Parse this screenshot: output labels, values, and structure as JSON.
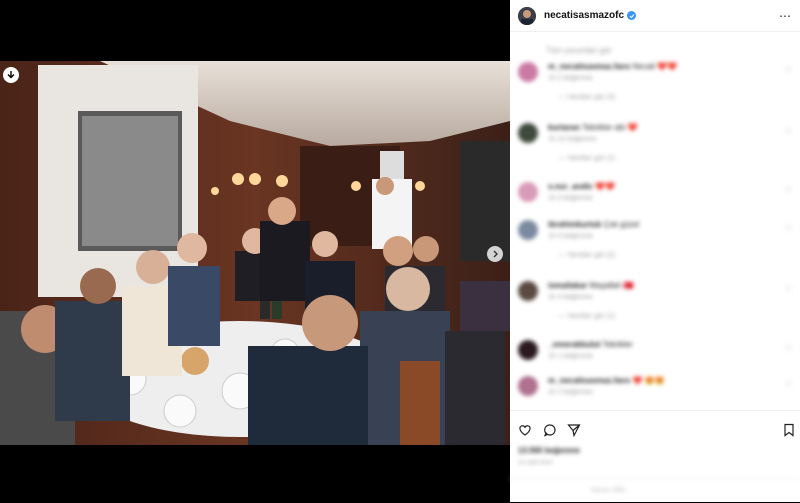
{
  "post": {
    "username": "necatisasmazofc",
    "more_icon": "⋯"
  },
  "comments": {
    "see_all": "Tüm yorumları gör",
    "items": [
      {
        "user": "m_necatisasmaz.fans",
        "text": "Necati ❤️❤️",
        "meta": "1h  2 beğenme",
        "reply": "—  Yanıtları gör (3)"
      },
      {
        "user": "kurtaran",
        "text": "Tebrikler abi ❤️",
        "meta": "1h  10 beğenme",
        "reply": "—  Yanıtları gör (1)"
      },
      {
        "user": "s.nur_andic",
        "text": "❤️❤️",
        "meta": "1h  3 beğenme",
        "reply": ""
      },
      {
        "user": "ibrahimkurtuk",
        "text": "Çok güzel",
        "meta": "1h  5 beğenme",
        "reply": "—  Yanıtları gör (2)"
      },
      {
        "user": "ismailakar",
        "text": "Maşallah 🇹🇷",
        "meta": "1h  4 beğenme",
        "reply": "—  Yanıtları gör (1)"
      },
      {
        "user": "_omerakbulut",
        "text": "Tebrikler",
        "meta": "1h  1 beğenme",
        "reply": ""
      },
      {
        "user": "m_necatisasmaz.fans",
        "text": "❤️ 😍😍",
        "meta": "1h  2 beğenme",
        "reply": ""
      }
    ]
  },
  "likes": "13.560 beğenme",
  "date": "15 saat önce",
  "add_comment": "Yorum ekle...",
  "colors": {
    "avatar_colors": [
      "#c97aa3",
      "#3f4a3c",
      "#d89ab8",
      "#7a8aa0",
      "#5a4a40",
      "#2a1a20",
      "#b07090"
    ]
  }
}
